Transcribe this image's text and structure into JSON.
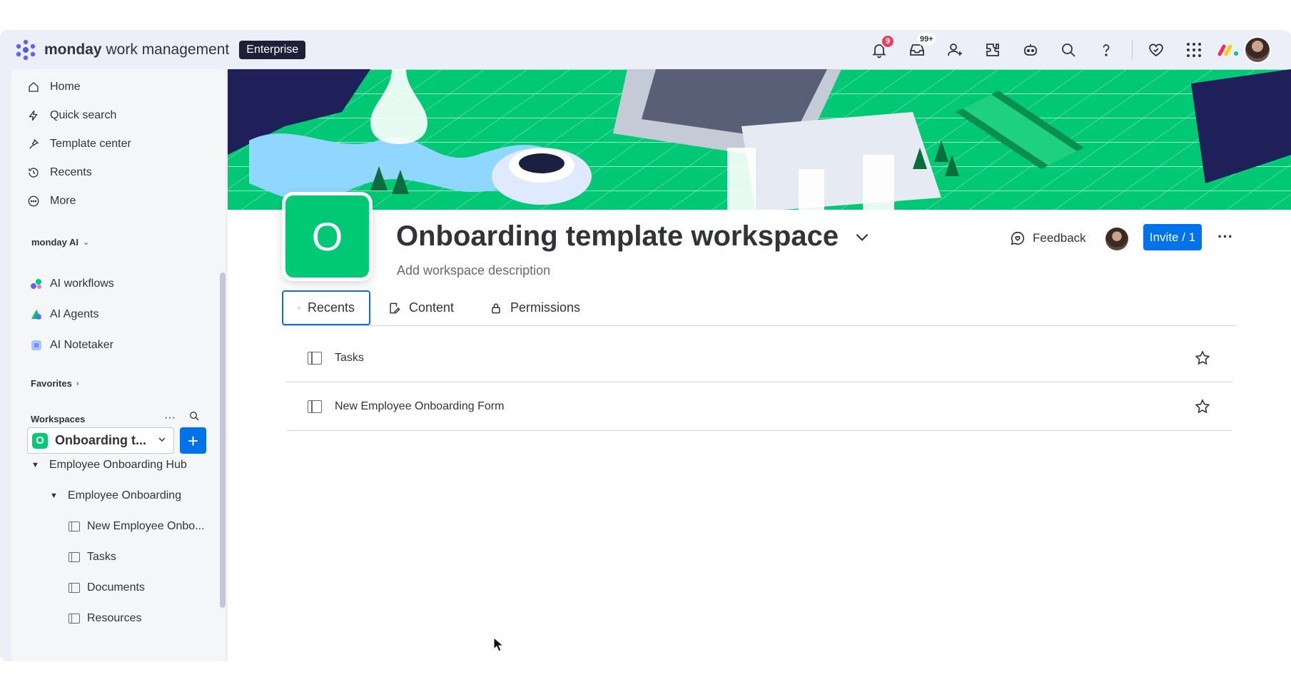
{
  "brand": {
    "name": "monday",
    "product": "work management",
    "plan": "Enterprise"
  },
  "topbar": {
    "notifications_count": "9",
    "inbox_count": "99+",
    "icons": [
      "bell-icon",
      "inbox-icon",
      "invite-members-icon",
      "apps-icon",
      "ai-bot-icon",
      "search-icon",
      "help-icon",
      "heart-icon",
      "grid-icon"
    ]
  },
  "sidebar": {
    "nav": [
      {
        "label": "Home",
        "icon": "home-icon"
      },
      {
        "label": "Quick search",
        "icon": "lightning-icon"
      },
      {
        "label": "Template center",
        "icon": "template-icon"
      },
      {
        "label": "Recents",
        "icon": "history-icon"
      },
      {
        "label": "More",
        "icon": "more-circle-icon"
      }
    ],
    "ai_section": {
      "title": "monday AI"
    },
    "ai_items": [
      {
        "label": "AI workflows"
      },
      {
        "label": "AI Agents"
      },
      {
        "label": "AI Notetaker"
      }
    ],
    "favorites": {
      "title": "Favorites"
    },
    "workspaces": {
      "title": "Workspaces",
      "selected_initial": "O",
      "selected_name": "Onboarding t..."
    },
    "tree": [
      {
        "label": "Employee Onboarding Hub"
      },
      {
        "label": "Employee Onboarding"
      },
      {
        "label": "New Employee Onbo..."
      },
      {
        "label": "Tasks"
      },
      {
        "label": "Documents"
      },
      {
        "label": "Resources"
      }
    ]
  },
  "workspace": {
    "initial": "O",
    "title": "Onboarding template workspace",
    "description": "Add workspace description",
    "feedback_label": "Feedback",
    "invite_label": "Invite / 1",
    "more_label": "···"
  },
  "tabs": [
    {
      "label": "Recents",
      "active": true
    },
    {
      "label": "Content",
      "active": false
    },
    {
      "label": "Permissions",
      "active": false
    }
  ],
  "recents": [
    {
      "label": "Tasks"
    },
    {
      "label": "New Employee Onboarding Form"
    }
  ],
  "colors": {
    "primary": "#0073ea",
    "workspace_green": "#00c875",
    "badge_red": "#e2445c",
    "text": "#323338",
    "muted": "#676879"
  }
}
